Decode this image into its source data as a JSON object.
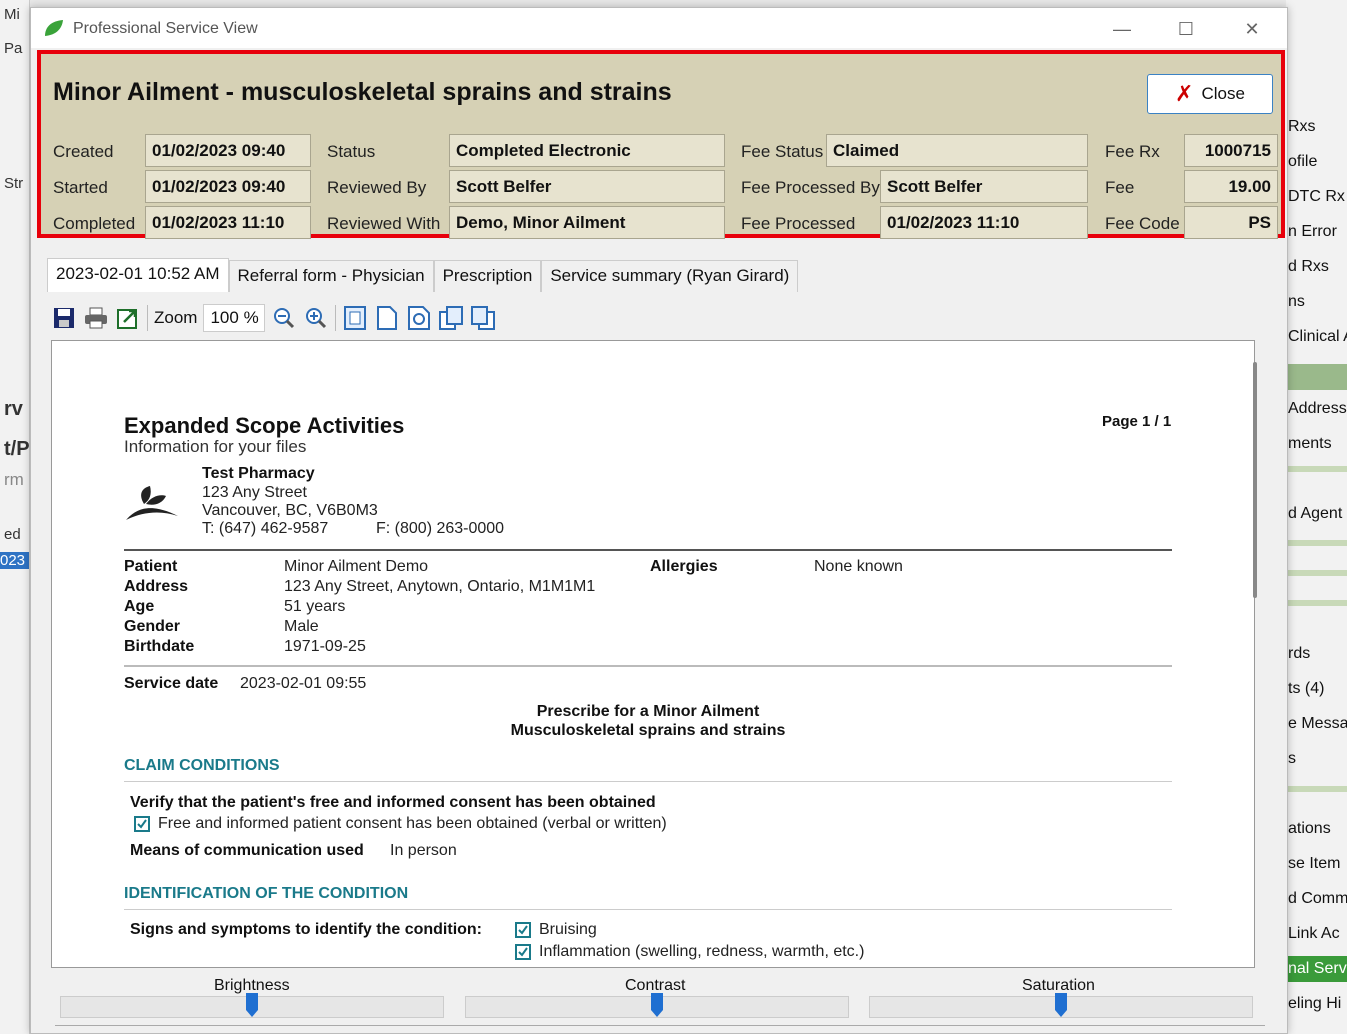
{
  "background_left": {
    "items": [
      "Mi",
      "Pa",
      "Str",
      "rv",
      "t/P",
      "rm",
      "ed",
      "023"
    ]
  },
  "background_right": {
    "items": [
      "Rxs",
      "ofile",
      "DTC Rx",
      "n Error",
      "d Rxs",
      "ns",
      "Clinical A",
      "",
      "Address",
      "ments",
      "",
      "d Agent",
      "",
      "",
      "",
      "rds",
      "ts (4)",
      "e Messa",
      "s",
      "",
      "ations",
      "se Item",
      "d Comm",
      "Link Ac",
      "nal Serv",
      "eling Hi"
    ]
  },
  "window": {
    "title": "Professional Service View",
    "minimize_glyph": "—",
    "maximize_glyph": "☐",
    "close_glyph": "✕"
  },
  "header": {
    "title": "Minor Ailment - musculoskeletal sprains and strains",
    "close_label": "Close",
    "created_label": "Created",
    "created_value": "01/02/2023 09:40",
    "started_label": "Started",
    "started_value": "01/02/2023 09:40",
    "completed_label": "Completed",
    "completed_value": "01/02/2023 11:10",
    "status_label": "Status",
    "status_value": "Completed Electronic",
    "reviewed_by_label": "Reviewed By",
    "reviewed_by_value": "Scott Belfer",
    "reviewed_with_label": "Reviewed With",
    "reviewed_with_value": "Demo, Minor Ailment",
    "fee_status_label": "Fee Status",
    "fee_status_value": "Claimed",
    "fee_processed_by_label": "Fee Processed By",
    "fee_processed_by_value": "Scott Belfer",
    "fee_processed_label": "Fee Processed",
    "fee_processed_value": "01/02/2023 11:10",
    "fee_rx_label": "Fee Rx",
    "fee_rx_value": "1000715",
    "fee_label": "Fee",
    "fee_value": "19.00",
    "fee_code_label": "Fee Code",
    "fee_code_value": "PS"
  },
  "tabs": [
    "2023-02-01 10:52 AM",
    "Referral form - Physician",
    "Prescription",
    "Service summary (Ryan Girard)"
  ],
  "toolbar": {
    "zoom_label": "Zoom",
    "zoom_value": "100",
    "zoom_unit": "%"
  },
  "document": {
    "title": "Expanded Scope Activities",
    "subtitle": "Information for your files",
    "page": "Page 1 / 1",
    "pharmacy_name": "Test Pharmacy",
    "pharmacy_street": "123 Any Street",
    "pharmacy_city": "Vancouver, BC, V6B0M3",
    "pharmacy_phone": "T: (647) 462-9587",
    "pharmacy_fax": "F: (800) 263-0000",
    "patient_label": "Patient",
    "patient_value": "Minor Ailment Demo",
    "address_label": "Address",
    "address_value": "123 Any Street, Anytown, Ontario, M1M1M1",
    "age_label": "Age",
    "age_value": "51 years",
    "gender_label": "Gender",
    "gender_value": "Male",
    "birthdate_label": "Birthdate",
    "birthdate_value": "1971-09-25",
    "allergies_label": "Allergies",
    "allergies_value": "None known",
    "service_date_label": "Service date",
    "service_date_value": "2023-02-01 09:55",
    "heading1": "Prescribe for a Minor Ailment",
    "heading2": "Musculoskeletal sprains and strains",
    "section1": "CLAIM CONDITIONS",
    "consent_question": "Verify that the patient's free and informed consent has been obtained",
    "consent_answer": "Free and informed patient consent has been obtained (verbal or written)",
    "communication_label": "Means of communication used",
    "communication_value": "In person",
    "section2": "IDENTIFICATION OF THE CONDITION",
    "signs_label": "Signs and symptoms to identify the condition:",
    "signs": [
      "Bruising",
      "Inflammation (swelling, redness, warmth, etc.)"
    ]
  },
  "adjustments": {
    "brightness_label": "Brightness",
    "brightness_level": 0.5,
    "contrast_label": "Contrast",
    "contrast_level": 0.5,
    "saturation_label": "Saturation",
    "saturation_level": 0.5
  },
  "colors": {
    "header_bg": "#d6d1b5",
    "highlight_border": "#e8000b",
    "section_teal": "#1a7a8a",
    "accent_blue": "#3b82c4",
    "slider_thumb": "#1f6fd1"
  }
}
